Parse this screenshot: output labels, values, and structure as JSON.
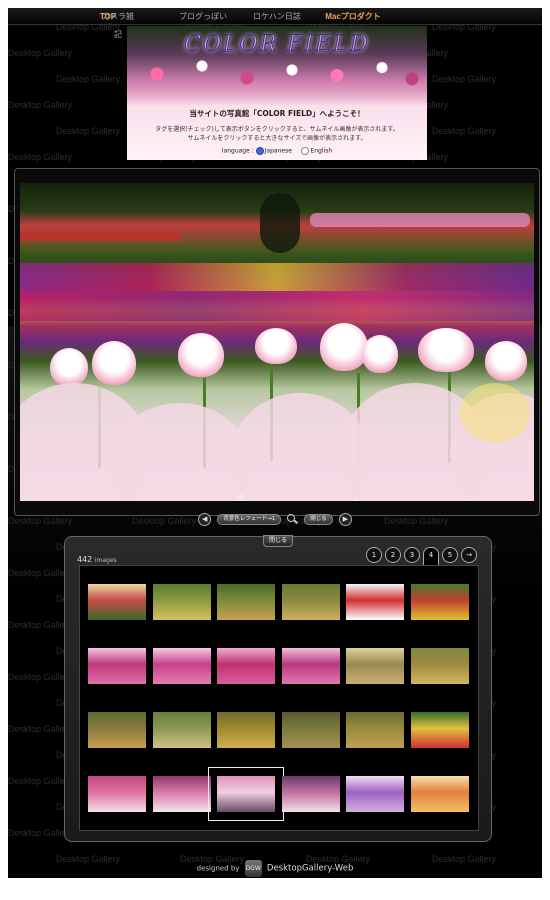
{
  "nav": {
    "items": [
      {
        "label": "TOP",
        "active": true
      },
      {
        "label": "カメラ雑記",
        "active": false
      },
      {
        "label": "ブログっぽい",
        "active": false
      },
      {
        "label": "ロケハン日誌",
        "active": false
      },
      {
        "label": "Macプロダクト",
        "active": false
      }
    ]
  },
  "hero": {
    "title": "COLOR FIELD",
    "welcome": "当サイトの写真館「COLOR FIELD」へようこそ！",
    "desc_line1": "タグを選択(チェック)して表示ボタンをクリックすると、サムネイル画像が表示されます。",
    "desc_line2": "サムネイルをクリックすると大きなサイズで画像が表示されます。",
    "language_label": "language :",
    "lang_options": [
      "Japanese",
      "English"
    ],
    "lang_selected": "Japanese"
  },
  "controls": {
    "prev_icon": "◀",
    "next_icon": "▶",
    "slideshow_label": "背景色レフェード→1",
    "close_label": "閉じる"
  },
  "gallery": {
    "close_label": "閉じる",
    "count": "442",
    "count_unit": "images",
    "pages": [
      "1",
      "2",
      "3",
      "4",
      "5",
      "→"
    ],
    "current_page": "4"
  },
  "watermark": "Desktop Gallery",
  "footer": {
    "designed_by": "designed by",
    "logo_text": "DGW",
    "brand": "DesktopGallery-Web"
  },
  "colors": {
    "accent": "#e8a45a",
    "background": "#000000",
    "hero_title": "#c9a0ff"
  }
}
